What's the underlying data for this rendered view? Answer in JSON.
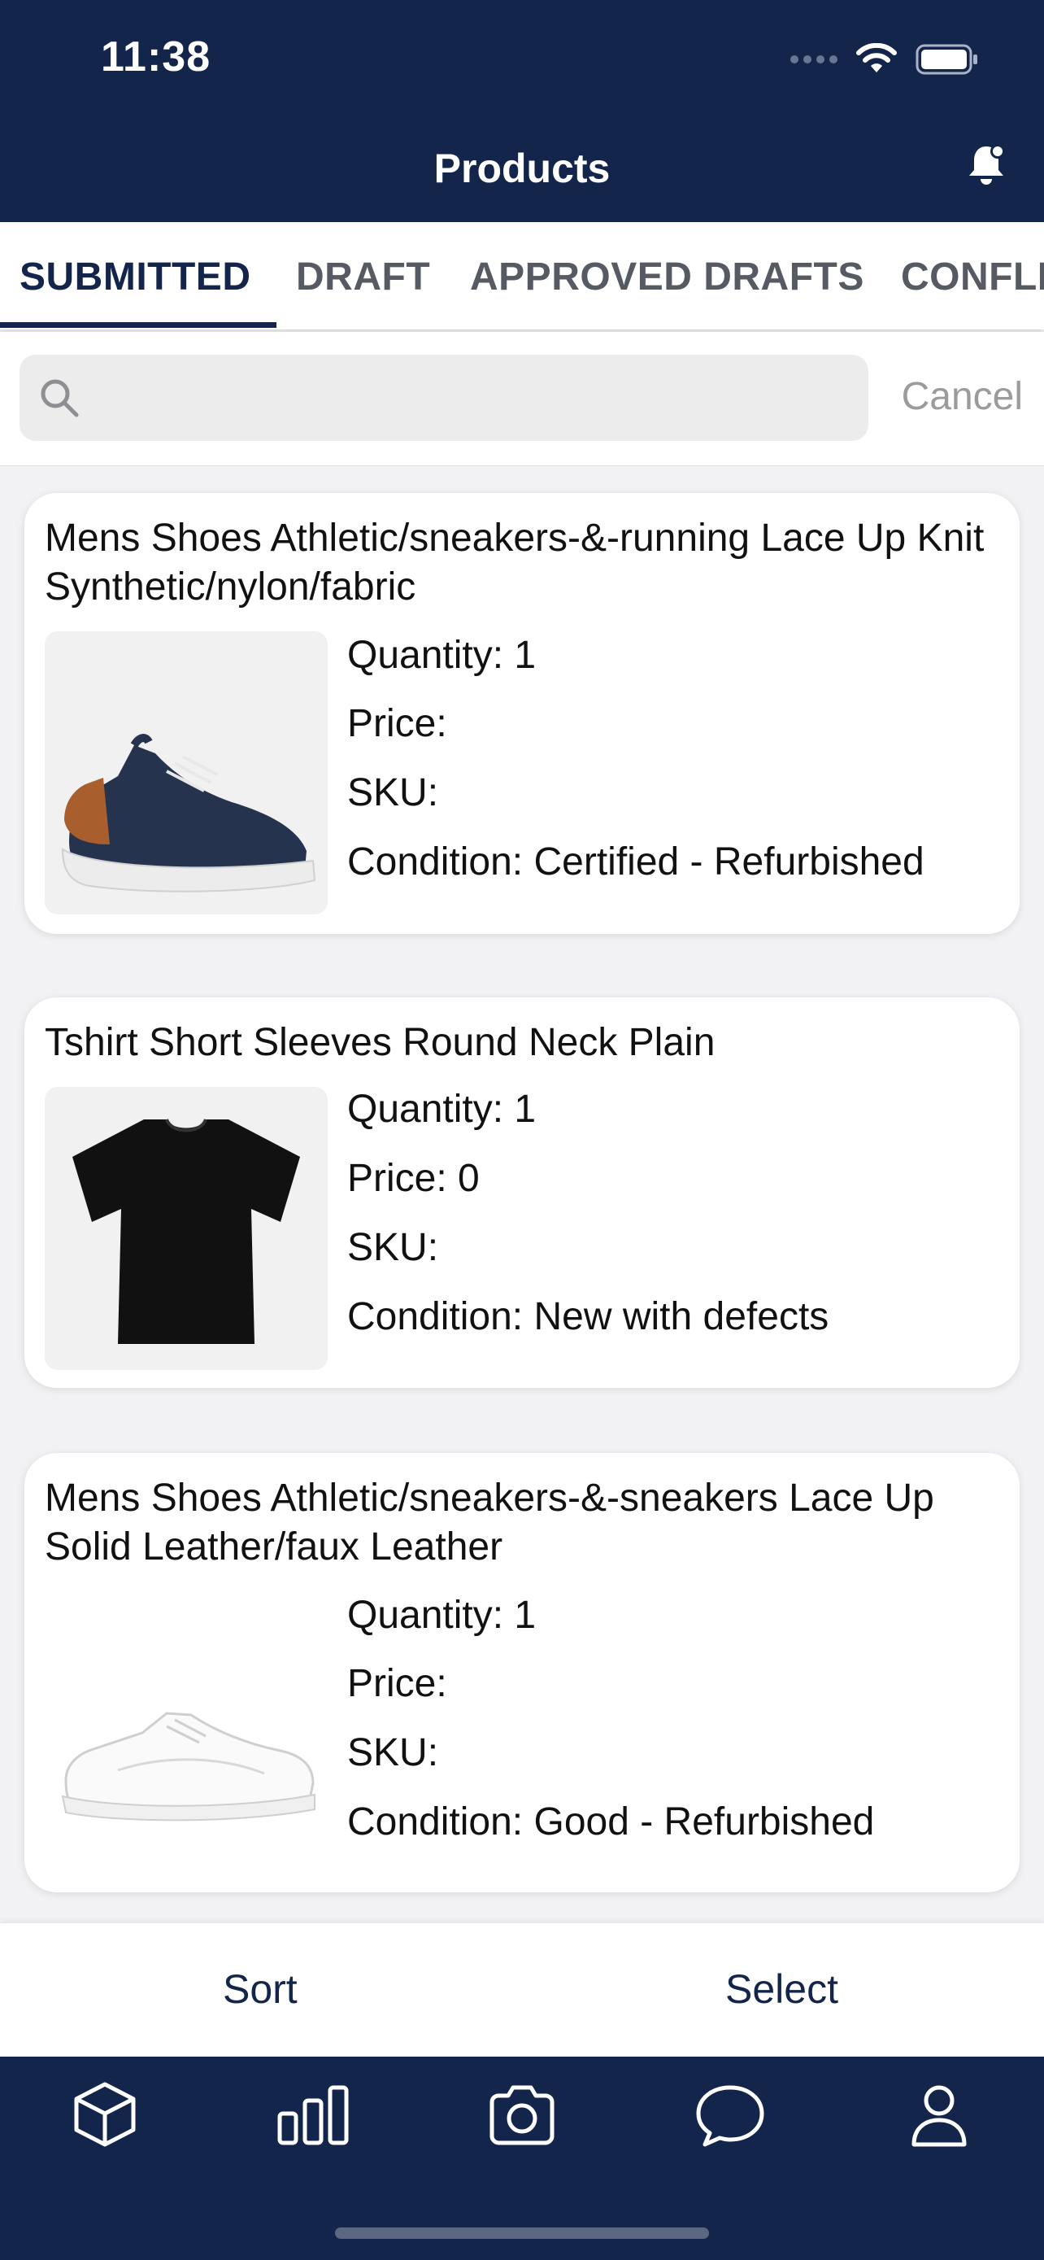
{
  "status_bar": {
    "time": "11:38"
  },
  "header": {
    "title": "Products"
  },
  "tabs": [
    {
      "label": "SUBMITTED",
      "active": true
    },
    {
      "label": "DRAFT",
      "active": false
    },
    {
      "label": "APPROVED DRAFTS",
      "active": false
    },
    {
      "label": "CONFLI",
      "active": false
    }
  ],
  "search": {
    "value": "",
    "placeholder": "",
    "cancel_label": "Cancel"
  },
  "products": [
    {
      "title": "Mens Shoes Athletic/sneakers-&-running Lace Up Knit Synthetic/nylon/fabric",
      "quantity": "Quantity: 1",
      "price": "Price:",
      "sku": "SKU:",
      "condition": "Condition: Certified - Refurbished",
      "image": "navy-knit-sneaker"
    },
    {
      "title": "Tshirt Short Sleeves Round Neck Plain",
      "quantity": "Quantity: 1",
      "price": "Price: 0",
      "sku": "SKU:",
      "condition": "Condition: New with defects",
      "image": "black-tshirt"
    },
    {
      "title": "Mens Shoes Athletic/sneakers-&-sneakers Lace Up Solid Leather/faux Leather",
      "quantity": "Quantity: 1",
      "price": "Price:",
      "sku": "SKU:",
      "condition": "Condition: Good - Refurbished",
      "image": "white-leather-sneaker"
    }
  ],
  "action_bar": {
    "sort_label": "Sort",
    "select_label": "Select"
  },
  "tabbar": {
    "items": [
      "cube-icon",
      "bar-chart-icon",
      "camera-icon",
      "chat-bubble-icon",
      "person-icon"
    ]
  },
  "colors": {
    "navy": "#13254a",
    "background": "#f2f2f4"
  }
}
